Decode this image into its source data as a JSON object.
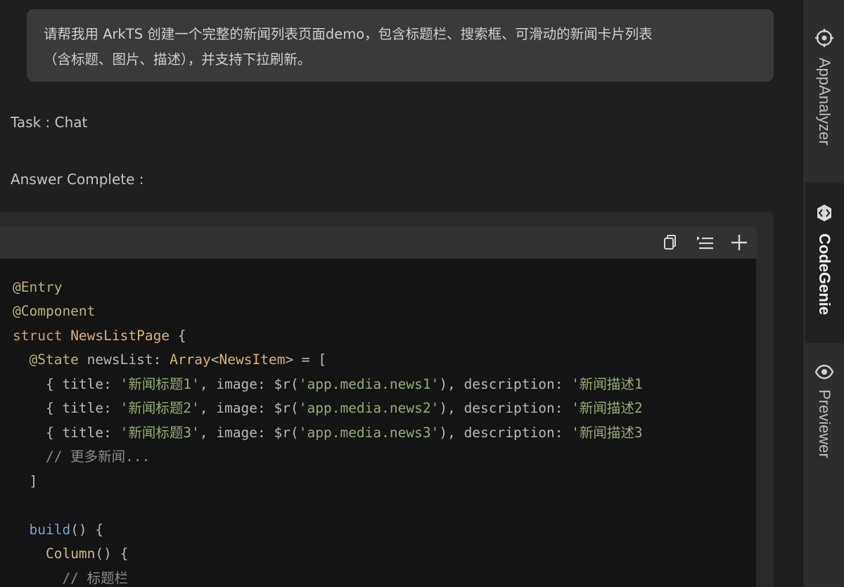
{
  "chat": {
    "prompt_lines": [
      "请帮我用 ArkTS 创建一个完整的新闻列表页面demo，包含标题栏、搜索框、可滑动的新闻卡片列表",
      "（含标题、图片、描述），并支持下拉刷新。"
    ],
    "task_label": "Task :",
    "task_value": "Chat",
    "answer_label": "Answer Complete :"
  },
  "code_toolbar": {
    "icons": [
      "copy-icon",
      "insert-lines-icon",
      "plus-icon"
    ]
  },
  "code": {
    "lines": [
      [
        {
          "t": "@Entry",
          "c": "deco"
        }
      ],
      [
        {
          "t": "@Component",
          "c": "deco"
        }
      ],
      [
        {
          "t": "struct ",
          "c": "kw"
        },
        {
          "t": "NewsListPage",
          "c": "type"
        },
        {
          "t": " {",
          "c": "var"
        }
      ],
      [
        {
          "t": "  ",
          "c": "var"
        },
        {
          "t": "@State",
          "c": "deco"
        },
        {
          "t": " newsList: ",
          "c": "var"
        },
        {
          "t": "Array",
          "c": "type"
        },
        {
          "t": "<",
          "c": "var"
        },
        {
          "t": "NewsItem",
          "c": "type"
        },
        {
          "t": "> = [",
          "c": "var"
        }
      ],
      [
        {
          "t": "    { title: ",
          "c": "var"
        },
        {
          "t": "'新闻标题1'",
          "c": "str"
        },
        {
          "t": ", image: $r(",
          "c": "var"
        },
        {
          "t": "'app.media.news1'",
          "c": "str"
        },
        {
          "t": "), description: ",
          "c": "var"
        },
        {
          "t": "'新闻描述1",
          "c": "str"
        }
      ],
      [
        {
          "t": "    { title: ",
          "c": "var"
        },
        {
          "t": "'新闻标题2'",
          "c": "str"
        },
        {
          "t": ", image: $r(",
          "c": "var"
        },
        {
          "t": "'app.media.news2'",
          "c": "str"
        },
        {
          "t": "), description: ",
          "c": "var"
        },
        {
          "t": "'新闻描述2",
          "c": "str"
        }
      ],
      [
        {
          "t": "    { title: ",
          "c": "var"
        },
        {
          "t": "'新闻标题3'",
          "c": "str"
        },
        {
          "t": ", image: $r(",
          "c": "var"
        },
        {
          "t": "'app.media.news3'",
          "c": "str"
        },
        {
          "t": "), description: ",
          "c": "var"
        },
        {
          "t": "'新闻描述3",
          "c": "str"
        }
      ],
      [
        {
          "t": "    // 更多新闻...",
          "c": "cm"
        }
      ],
      [
        {
          "t": "  ]",
          "c": "var"
        }
      ],
      [
        {
          "t": "",
          "c": "var"
        }
      ],
      [
        {
          "t": "  ",
          "c": "var"
        },
        {
          "t": "build",
          "c": "fn"
        },
        {
          "t": "() {",
          "c": "var"
        }
      ],
      [
        {
          "t": "    ",
          "c": "var"
        },
        {
          "t": "Column",
          "c": "call"
        },
        {
          "t": "() {",
          "c": "var"
        }
      ],
      [
        {
          "t": "      // 标题栏",
          "c": "cm"
        }
      ]
    ]
  },
  "sidebar": {
    "tabs": [
      {
        "label": "AppAnalyzer",
        "icon": "app-analyzer-icon",
        "active": false
      },
      {
        "label": "CodeGenie",
        "icon": "codegenie-icon",
        "active": true
      },
      {
        "label": "Previewer",
        "icon": "eye-icon",
        "active": false
      }
    ]
  }
}
